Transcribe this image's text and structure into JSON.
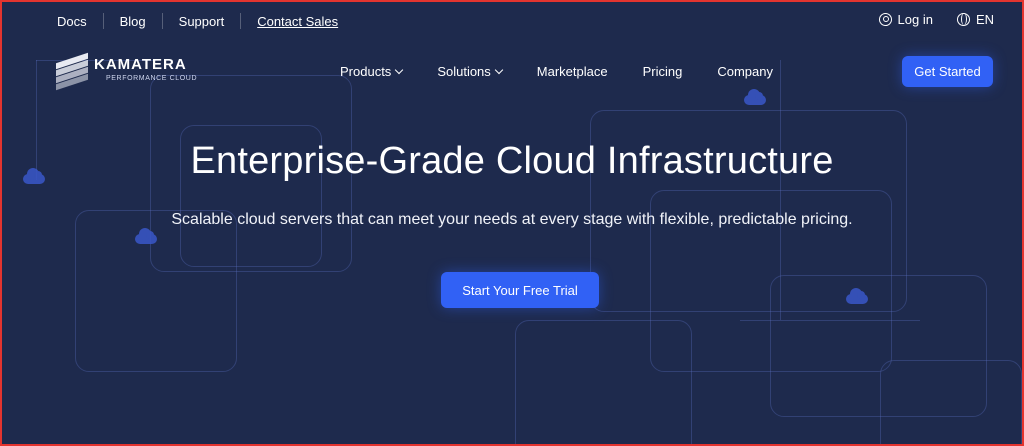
{
  "topbar": {
    "links": [
      "Docs",
      "Blog",
      "Support",
      "Contact Sales"
    ],
    "login_label": "Log in",
    "language_label": "EN",
    "login_icon": "user-icon",
    "language_icon": "globe-icon"
  },
  "logo": {
    "name": "KAMATERA",
    "tagline": "PERFORMANCE CLOUD"
  },
  "nav": {
    "items": [
      {
        "label": "Products",
        "has_dropdown": true
      },
      {
        "label": "Solutions",
        "has_dropdown": true
      },
      {
        "label": "Marketplace",
        "has_dropdown": false
      },
      {
        "label": "Pricing",
        "has_dropdown": false
      },
      {
        "label": "Company",
        "has_dropdown": false
      }
    ],
    "cta_label": "Get Started"
  },
  "hero": {
    "title": "Enterprise-Grade Cloud Infrastructure",
    "subtitle": "Scalable cloud servers that can meet your needs at every stage with flexible, predictable pricing.",
    "cta_label": "Start Your Free Trial"
  },
  "colors": {
    "background": "#1e2a4d",
    "accent": "#3161f5",
    "frame_border": "#e3342f"
  }
}
